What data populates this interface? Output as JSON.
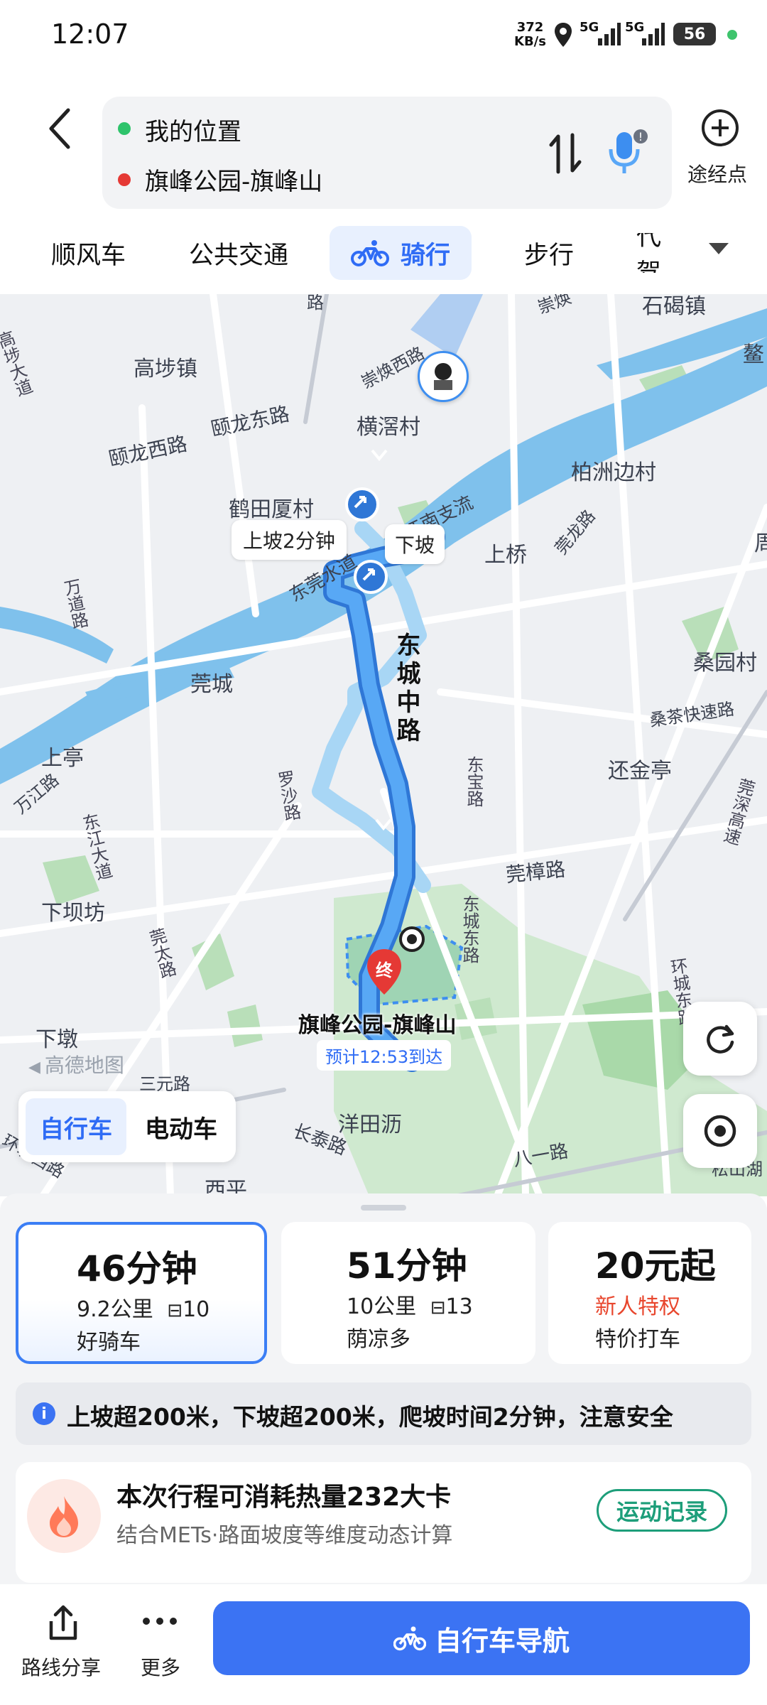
{
  "status": {
    "time": "12:07",
    "speed_value": "372",
    "speed_unit": "KB/s",
    "net1": "5G",
    "net2": "5G",
    "battery": "56"
  },
  "route": {
    "origin": "我的位置",
    "destination": "旗峰公园-旗峰山",
    "waypoint_label": "途经点"
  },
  "tabs": [
    {
      "label": "顺风车"
    },
    {
      "label": "公共交通"
    },
    {
      "label": "骑行"
    },
    {
      "label": "步行"
    },
    {
      "label": "代驾"
    }
  ],
  "map": {
    "labels": {
      "gaobu": "高埗镇",
      "shijie": "石碣镇",
      "aotou": "鳌",
      "hengxicun": "横滘村",
      "baizhoubiancun": "柏洲边村",
      "hetianxiacun": "鹤田厦村",
      "shangqiao": "上桥",
      "guancheng": "莞城",
      "sangyuancun": "桑园村",
      "shangting": "上亭",
      "huanjinting": "还金亭",
      "xiabafang": "下坝坊",
      "xiadun": "下墩",
      "yangtianli": "洋田沥",
      "xiping": "西平",
      "zhou": "周",
      "yilonglu": "颐龙东路",
      "yilongxilu": "颐龙西路",
      "chonghuanxilu": "崇焕西路",
      "dongguanshuidao": "东莞水道",
      "dongjiang": "东江南支流",
      "guanlonglu": "莞龙路",
      "wanjiangdao": "万道路",
      "sangchakuaisu": "桑茶快速路",
      "dongbaolu": "东宝路",
      "guanzhanglu": "莞樟路",
      "luoshalu": "罗沙路",
      "guantailu": "莞太路",
      "dongchengdonglu": "东城东路",
      "huanchengdonglu": "环城东路",
      "changtailu": "长泰路",
      "bayilu": "八一路",
      "songshanhu": "松山湖",
      "guanshenlu": "莞深高速",
      "dongjiang_dadao": "东江大道",
      "xiaohaidao": "高埗大道",
      "lu_top": "路",
      "chonghuan2": "崇焕",
      "wanjianglu_left": "万江路",
      "sanyuanlu": "三元路",
      "xiuhuxilu": "环城西路"
    },
    "main_road": "东城中路",
    "uphill_tag": "上坡2分钟",
    "downhill_tag": "下坡",
    "end_marker": "终",
    "destination_name": "旗峰公园-旗峰山",
    "eta": "预计12:53到达",
    "watermark": "高德地图",
    "modes": [
      {
        "label": "自行车"
      },
      {
        "label": "电动车"
      }
    ]
  },
  "options": [
    {
      "time": "46分钟",
      "distance": "9.2公里",
      "lights": "10",
      "tag": "好骑车"
    },
    {
      "time": "51分钟",
      "distance": "10公里",
      "lights": "13",
      "tag": "荫凉多"
    },
    {
      "time": "20元起",
      "promo": "新人特权",
      "tag": "特价打车"
    }
  ],
  "notice": "上坡超200米，下坡超200米，爬坡时间2分钟，注意安全",
  "calorie": {
    "title": "本次行程可消耗热量232大卡",
    "subtitle": "结合METs·路面坡度等维度动态计算",
    "record_button": "运动记录"
  },
  "bottom": {
    "share_label": "路线分享",
    "more_label": "更多",
    "navigate_label": "自行车导航"
  },
  "colors": {
    "accent": "#3b73f3",
    "route_blue": "#3d8ef0",
    "origin_dot": "#2ec36b",
    "dest_dot": "#e53935",
    "promo_red": "#e8462d",
    "record_green": "#1d9e7a"
  }
}
